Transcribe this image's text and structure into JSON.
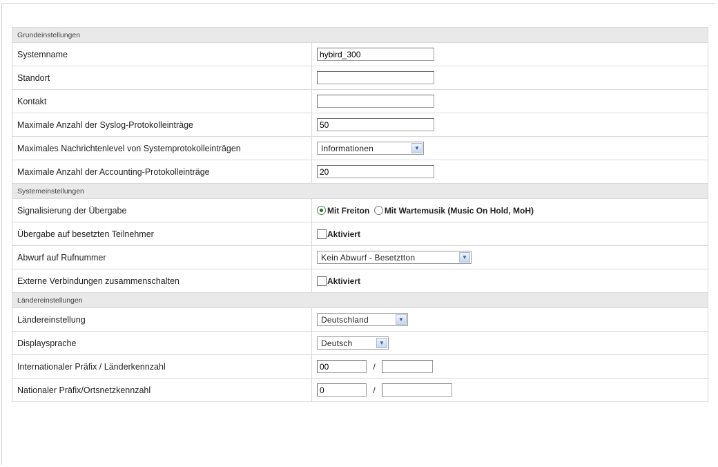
{
  "sections": {
    "grund": "Grundeinstellungen",
    "system": "Systemeinstellungen",
    "laender": "Ländereinstellungen"
  },
  "grund": {
    "systemname": {
      "label": "Systemname",
      "value": "hybird_300"
    },
    "standort": {
      "label": "Standort",
      "value": ""
    },
    "kontakt": {
      "label": "Kontakt",
      "value": ""
    },
    "syslog_max": {
      "label": "Maximale Anzahl der Syslog-Protokolleinträge",
      "value": "50"
    },
    "msg_level": {
      "label": "Maximales Nachrichtenlevel von Systemprotokolleinträgen",
      "selected": "Informationen"
    },
    "accounting_max": {
      "label": "Maximale Anzahl der Accounting-Protokolleinträge",
      "value": "20"
    }
  },
  "system": {
    "signal": {
      "label": "Signalisierung der Übergabe",
      "option1": "Mit Freiton",
      "option2": "Mit Wartemusik (Music On Hold, MoH)",
      "selected": "option1"
    },
    "busy_transfer": {
      "label": "Übergabe auf besetzten Teilnehmer",
      "checkbox_label": "Aktiviert",
      "checked": false
    },
    "abwurf": {
      "label": "Abwurf auf Rufnummer",
      "selected": "Kein Abwurf - Besetztton"
    },
    "extern_connect": {
      "label": "Externe Verbindungen zusammenschalten",
      "checkbox_label": "Aktiviert",
      "checked": false
    }
  },
  "laender": {
    "land": {
      "label": "Ländereinstellung",
      "selected": "Deutschland"
    },
    "sprache": {
      "label": "Displaysprache",
      "selected": "Deutsch"
    },
    "intl": {
      "label": "Internationaler Präfix / Länderkennzahl",
      "prefix": "00",
      "code": "",
      "separator": "/"
    },
    "national": {
      "label": "Nationaler Präfix/Ortsnetzkennzahl",
      "prefix": "0",
      "code": "",
      "separator": "/"
    }
  },
  "icons": {
    "dropdown": "chevron-down-icon"
  }
}
